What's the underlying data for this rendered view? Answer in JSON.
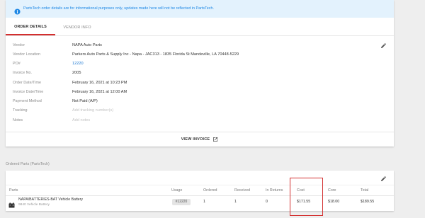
{
  "banner": {
    "icon": "info-icon",
    "text": "PartsTech order details are for informational purposes only, updates made here will not be reflected in PartsTech."
  },
  "tabs": [
    {
      "label": "ORDER DETAILS",
      "active": true
    },
    {
      "label": "VENDOR INFO",
      "active": false
    }
  ],
  "details": [
    {
      "label": "Vendor",
      "value": "NAPA Auto Parts"
    },
    {
      "label": "Vendor Location",
      "value": "Parkers Auto Parts & Supply Inc - Napa - JAC313 - 1835 Florida St Mandeville, LA 70448-5229"
    },
    {
      "label": "PO#",
      "value": "12220"
    },
    {
      "label": "Invoice No.",
      "value": "2005"
    },
    {
      "label": "Order Date/Time",
      "value": "February 16, 2021 at 10:23 PM"
    },
    {
      "label": "Invoice Date/Time",
      "value": "February 16, 2021 at 12:00 AM"
    },
    {
      "label": "Payment Method",
      "value": "Not Paid (A/P)"
    },
    {
      "label": "Tracking",
      "placeholder": "Add tracking number(s)"
    },
    {
      "label": "Notes",
      "placeholder": "Add notes"
    }
  ],
  "edit_icon": "pencil-icon",
  "view_invoice": {
    "label": "VIEW INVOICE",
    "icon": "external-link-icon"
  },
  "ordered_parts": {
    "title": "Ordered Parts (PartsTech)",
    "headers": [
      "Parts",
      "Usage",
      "Ordered",
      "Received",
      "In Returns",
      "Cost",
      "Core",
      "Total"
    ],
    "rows": [
      {
        "icon": "battery-icon",
        "name": "NAPA/BATTERIES-BAT Vehicle Battery",
        "subtitle": "9840 Vehicle Battery",
        "usage": "#12220",
        "ordered": "1",
        "received": "1",
        "in_returns": "0",
        "cost": "$171.55",
        "core": "$18.00",
        "total": "$189.55"
      }
    ]
  },
  "colors": {
    "accent": "#d32f2f",
    "link": "#1976d2",
    "banner_bg": "#e3f2fd",
    "banner_text": "#1e88e5",
    "highlight": "#d32f2f"
  }
}
